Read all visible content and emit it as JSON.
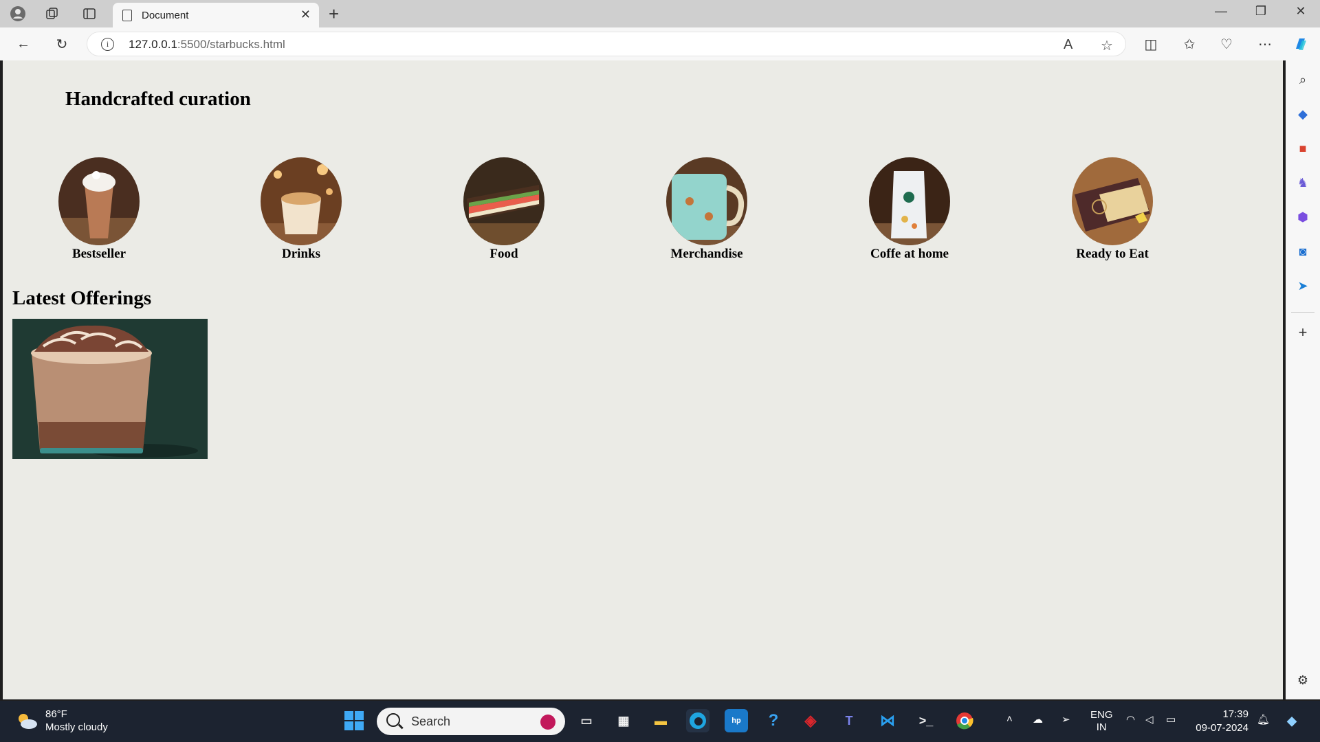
{
  "browser": {
    "tab_title": "Document",
    "url_host": "127.0.0.1",
    "url_rest": ":5500/starbucks.html"
  },
  "page": {
    "heading": "Handcrafted curation",
    "categories": [
      {
        "label": "Bestseller"
      },
      {
        "label": "Drinks"
      },
      {
        "label": "Food"
      },
      {
        "label": "Merchandise"
      },
      {
        "label": "Coffe at home"
      },
      {
        "label": "Ready to Eat"
      }
    ],
    "offerings_heading": "Latest Offerings"
  },
  "taskbar": {
    "temperature": "86°F",
    "weather": "Mostly cloudy",
    "search_placeholder": "Search",
    "lang_top": "ENG",
    "lang_bottom": "IN",
    "time": "17:39",
    "date": "09-07-2024"
  }
}
